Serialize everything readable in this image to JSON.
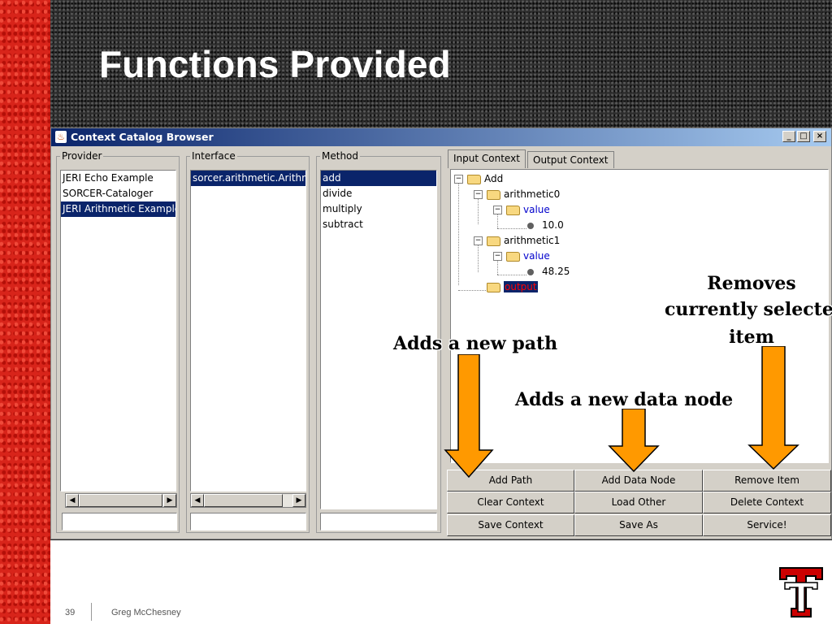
{
  "slide": {
    "title": "Functions Provided",
    "page_number": "39",
    "author": "Greg McChesney"
  },
  "window": {
    "title": "Context Catalog Browser",
    "controls": {
      "minimize": "_",
      "maximize": "□",
      "close": "×"
    }
  },
  "provider": {
    "legend": "Provider",
    "items": [
      "JERI Echo Example",
      "SORCER-Cataloger",
      "JERI Arithmetic Example"
    ],
    "selected": "JERI Arithmetic Example"
  },
  "interface": {
    "legend": "Interface",
    "items": [
      "sorcer.arithmetic.Arithm"
    ],
    "selected": "sorcer.arithmetic.Arithm"
  },
  "method": {
    "legend": "Method",
    "items": [
      "add",
      "divide",
      "multiply",
      "subtract"
    ],
    "selected": "add"
  },
  "tabs": [
    "Input Context",
    "Output Context"
  ],
  "tree": {
    "root": "Add",
    "nodes": [
      "arithmetic0",
      "value",
      "10.0",
      "arithmetic1",
      "value",
      "48.25",
      "output"
    ]
  },
  "buttons": [
    [
      "Add Path",
      "Add Data Node",
      "Remove Item"
    ],
    [
      "Clear Context",
      "Load Other",
      "Delete Context"
    ],
    [
      "Save Context",
      "Save As",
      "Service!"
    ]
  ],
  "annotations": {
    "add_path": "Adds a new path",
    "add_data_node": "Adds a new data node",
    "remove_line1": "Removes",
    "remove_line2": "currently selected",
    "remove_line3": "item"
  },
  "colors": {
    "selection": "#0a246a",
    "arrow_fill": "#ff9900",
    "link_text": "#0000cc",
    "output_text": "#ff0000",
    "slide_red": "#d8241a"
  }
}
